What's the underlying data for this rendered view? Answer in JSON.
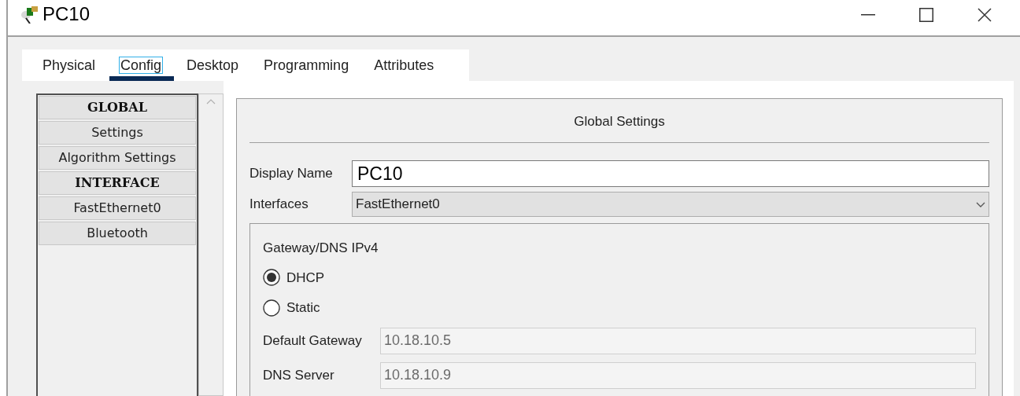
{
  "window": {
    "title": "PC10"
  },
  "tabs": [
    {
      "label": "Physical",
      "selected": false
    },
    {
      "label": "Config",
      "selected": true
    },
    {
      "label": "Desktop",
      "selected": false
    },
    {
      "label": "Programming",
      "selected": false
    },
    {
      "label": "Attributes",
      "selected": false
    }
  ],
  "sidebar": {
    "items": [
      {
        "label": "GLOBAL",
        "kind": "header"
      },
      {
        "label": "Settings",
        "kind": "item"
      },
      {
        "label": "Algorithm Settings",
        "kind": "item"
      },
      {
        "label": "INTERFACE",
        "kind": "header"
      },
      {
        "label": "FastEthernet0",
        "kind": "item"
      },
      {
        "label": "Bluetooth",
        "kind": "item"
      }
    ]
  },
  "panel": {
    "title": "Global Settings",
    "display_name": {
      "label": "Display Name",
      "value": "PC10"
    },
    "interfaces": {
      "label": "Interfaces",
      "value": "FastEthernet0"
    },
    "gateway_dns": {
      "title": "Gateway/DNS IPv4",
      "modes": [
        {
          "label": "DHCP",
          "selected": true
        },
        {
          "label": "Static",
          "selected": false
        }
      ],
      "fields": [
        {
          "label": "Default Gateway",
          "value": "10.18.10.5"
        },
        {
          "label": "DNS Server",
          "value": "10.18.10.9"
        }
      ]
    }
  }
}
